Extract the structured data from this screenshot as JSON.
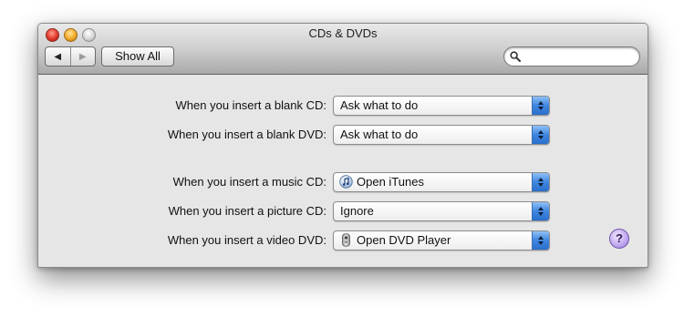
{
  "window": {
    "title": "CDs & DVDs"
  },
  "toolbar": {
    "back_label": "◀",
    "forward_label": "▶",
    "show_all_label": "Show All",
    "search": {
      "value": "",
      "placeholder": ""
    }
  },
  "settings": [
    {
      "label": "When you insert a blank CD:",
      "value": "Ask what to do",
      "icon": ""
    },
    {
      "label": "When you insert a blank DVD:",
      "value": "Ask what to do",
      "icon": ""
    },
    {
      "label": "When you insert a music CD:",
      "value": "Open iTunes",
      "icon": "itunes-icon"
    },
    {
      "label": "When you insert a picture CD:",
      "value": "Ignore",
      "icon": ""
    },
    {
      "label": "When you insert a video DVD:",
      "value": "Open DVD Player",
      "icon": "dvd-player-icon"
    }
  ],
  "help": {
    "label": "?"
  },
  "colors": {
    "popup_arrow_blue": "#3f86e0",
    "help_purple": "#bfa5ef",
    "close_red": "#e0372a",
    "minimize_yellow": "#f3a928"
  }
}
